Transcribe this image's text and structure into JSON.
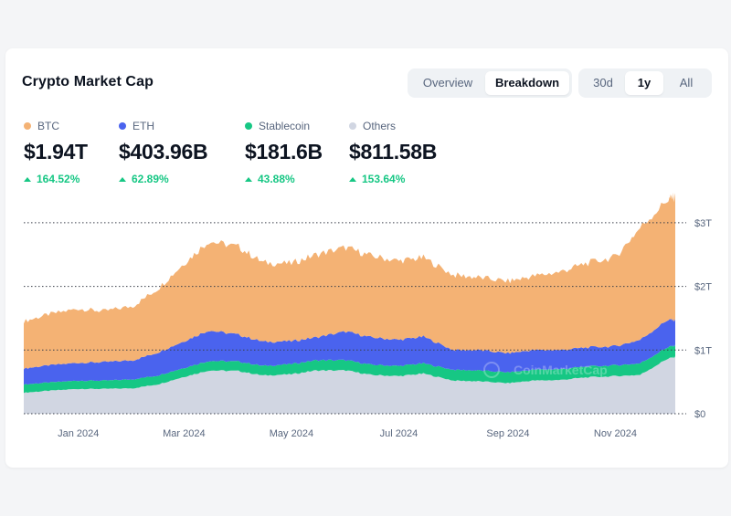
{
  "header": {
    "title": "Crypto Market Cap",
    "view_tabs": [
      {
        "label": "Overview",
        "active": false
      },
      {
        "label": "Breakdown",
        "active": true
      }
    ],
    "range_tabs": [
      {
        "label": "30d",
        "active": false
      },
      {
        "label": "1y",
        "active": true
      },
      {
        "label": "All",
        "active": false
      }
    ]
  },
  "legend": [
    {
      "label": "BTC",
      "value": "$1.94T",
      "change": "164.52%",
      "color": "#f4b274"
    },
    {
      "label": "ETH",
      "value": "$403.96B",
      "change": "62.89%",
      "color": "#4a63ee"
    },
    {
      "label": "Stablecoin",
      "value": "$181.6B",
      "change": "43.88%",
      "color": "#16c784"
    },
    {
      "label": "Others",
      "value": "$811.58B",
      "change": "153.64%",
      "color": "#d1d6e2"
    }
  ],
  "watermark": "CoinMarketCap",
  "chart_data": {
    "type": "area",
    "stacked": true,
    "x": [
      "2023-12-01",
      "2023-12-15",
      "2024-01-01",
      "2024-01-15",
      "2024-02-01",
      "2024-02-15",
      "2024-03-01",
      "2024-03-15",
      "2024-04-01",
      "2024-04-15",
      "2024-05-01",
      "2024-05-15",
      "2024-06-01",
      "2024-06-15",
      "2024-07-01",
      "2024-07-15",
      "2024-08-01",
      "2024-08-15",
      "2024-09-01",
      "2024-09-15",
      "2024-10-01",
      "2024-10-15",
      "2024-11-01",
      "2024-11-15",
      "2024-12-01",
      "2024-12-05"
    ],
    "x_ticks": [
      "Jan 2024",
      "Mar 2024",
      "May 2024",
      "Jul 2024",
      "Sep 2024",
      "Nov 2024"
    ],
    "y_ticks": [
      "$0",
      "$1T",
      "$2T",
      "$3T"
    ],
    "ylim": [
      0,
      3.3
    ],
    "y_unit": "trillion USD",
    "grid": "horizontal dotted",
    "series": [
      {
        "name": "Others",
        "color": "#d1d6e2",
        "values": [
          0.33,
          0.36,
          0.39,
          0.39,
          0.4,
          0.46,
          0.58,
          0.68,
          0.67,
          0.6,
          0.62,
          0.68,
          0.68,
          0.61,
          0.59,
          0.63,
          0.52,
          0.51,
          0.48,
          0.52,
          0.53,
          0.57,
          0.59,
          0.61,
          0.87,
          0.89
        ]
      },
      {
        "name": "Stablecoin",
        "color": "#16c784",
        "values": [
          0.13,
          0.13,
          0.13,
          0.13,
          0.14,
          0.14,
          0.14,
          0.15,
          0.15,
          0.15,
          0.16,
          0.16,
          0.16,
          0.16,
          0.16,
          0.16,
          0.17,
          0.17,
          0.17,
          0.17,
          0.17,
          0.17,
          0.17,
          0.18,
          0.18,
          0.18
        ]
      },
      {
        "name": "ETH",
        "color": "#4a63ee",
        "values": [
          0.25,
          0.27,
          0.28,
          0.29,
          0.3,
          0.36,
          0.42,
          0.48,
          0.42,
          0.38,
          0.36,
          0.36,
          0.45,
          0.43,
          0.41,
          0.42,
          0.31,
          0.32,
          0.3,
          0.31,
          0.3,
          0.3,
          0.3,
          0.37,
          0.43,
          0.4
        ]
      },
      {
        "name": "BTC",
        "color": "#f4b274",
        "values": [
          0.74,
          0.8,
          0.85,
          0.8,
          0.85,
          1.0,
          1.22,
          1.4,
          1.38,
          1.24,
          1.22,
          1.3,
          1.32,
          1.28,
          1.24,
          1.24,
          1.18,
          1.14,
          1.13,
          1.16,
          1.23,
          1.32,
          1.4,
          1.76,
          1.89,
          1.94
        ]
      }
    ]
  }
}
